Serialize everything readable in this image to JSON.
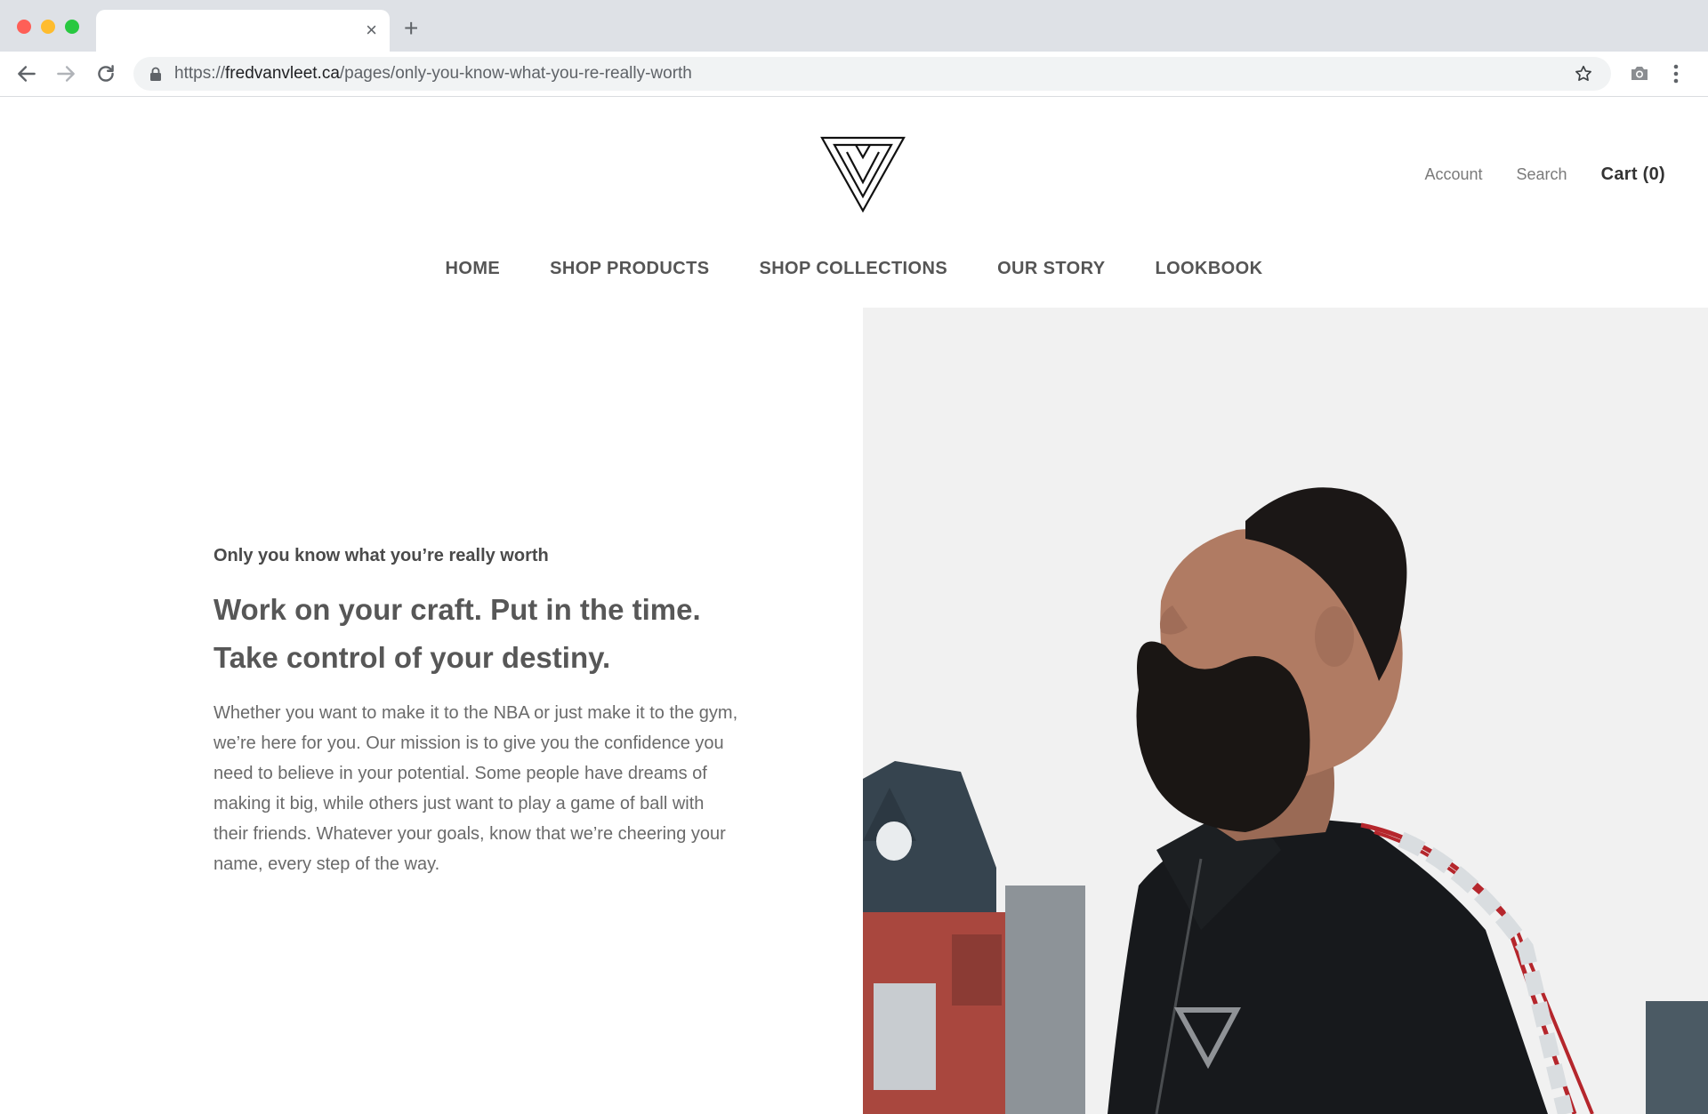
{
  "browser": {
    "tab_title": "",
    "url_scheme": "https://",
    "url_host": "fredvanvleet.ca",
    "url_path": "/pages/only-you-know-what-you-re-really-worth",
    "tab_close_glyph": "×",
    "new_tab_glyph": "+"
  },
  "header": {
    "logo_icon": "fv-triangle-logo",
    "account_label": "Account",
    "search_label": "Search",
    "cart_label": "Cart (0)"
  },
  "nav": {
    "items": [
      {
        "label": "HOME",
        "active": false
      },
      {
        "label": "SHOP PRODUCTS",
        "active": false
      },
      {
        "label": "SHOP COLLECTIONS",
        "active": false
      },
      {
        "label": "OUR STORY",
        "active": true
      },
      {
        "label": "LOOKBOOK",
        "active": false
      }
    ]
  },
  "story": {
    "kicker": "Only you know what you’re really worth",
    "headline": "Work on your craft. Put in the time. Take control of your destiny.",
    "body": "Whether you want to make it to the NBA or just make it to the gym, we’re here for you. Our mission is to give you the confidence you need to believe in your potential. Some people have dreams of making it big, while others just want to play a game of ball with their friends. Whatever your goals, know that we’re cheering your name, every step of the way."
  },
  "colors": {
    "chrome_bar": "#dee1e6",
    "omnibox": "#f1f3f4",
    "text_dark": "#333333",
    "text_muted": "#7a7a7a"
  }
}
